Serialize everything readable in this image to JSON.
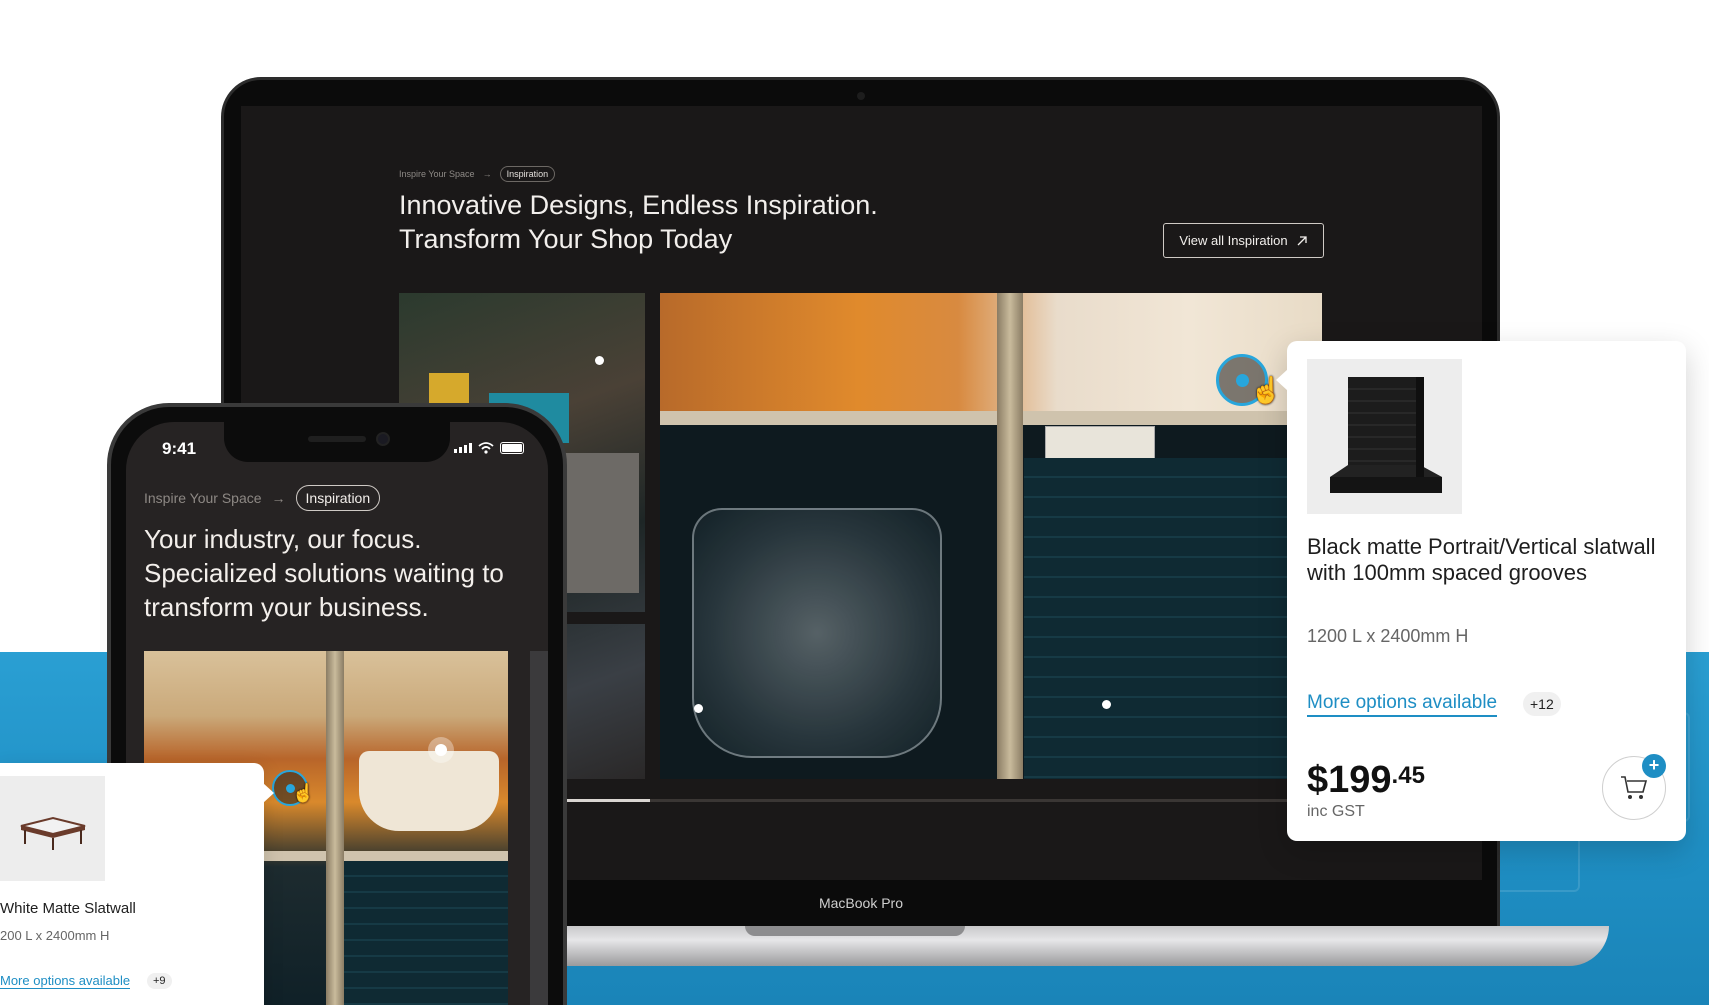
{
  "laptop": {
    "device_label": "MacBook Pro",
    "breadcrumb": {
      "parent": "Inspire Your Space",
      "separator": "→",
      "current": "Inspiration"
    },
    "title_line1": "Innovative Designs, Endless Inspiration.",
    "title_line2": "Transform Your Shop Today",
    "view_all_label": "View all Inspiration",
    "view_all_icon": "arrow-up-right-icon",
    "carousel_progress": 0.11
  },
  "product_popup": {
    "title": "Black matte Portrait/Vertical slatwall with 100mm spaced grooves",
    "dimensions": "1200 L x 2400mm H",
    "more_options_label": "More options available",
    "more_options_count": "+12",
    "price_dollars": "$199",
    "price_cents": ".45",
    "tax_note": "inc GST",
    "cart_icon": "cart-icon",
    "cart_plus": "+"
  },
  "phone": {
    "time": "9:41",
    "breadcrumb": {
      "parent": "Inspire Your Space",
      "separator": "→",
      "current": "Inspiration"
    },
    "title": "Your industry, our focus. Specialized solutions waiting to transform your business."
  },
  "mini_popup": {
    "title": "White Matte Slatwall",
    "dimensions": "200 L x 2400mm H",
    "more_options_label": "More options available",
    "more_options_count": "+9"
  },
  "colors": {
    "accent": "#1e8ec4",
    "hotspot": "#28a6dc",
    "screen_bg": "#1a1818",
    "band": "#2a9fd3"
  }
}
